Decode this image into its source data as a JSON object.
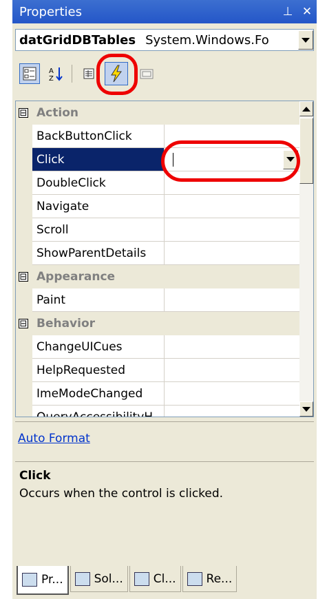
{
  "window": {
    "title": "Properties",
    "pin_icon": "pin-icon",
    "close_icon": "close-icon"
  },
  "object_selector": {
    "name": "datGridDBTables",
    "type": "System.Windows.Fo"
  },
  "toolbar": {
    "buttons": [
      {
        "name": "categorized-button",
        "icon": "categorized-icon",
        "pressed": true
      },
      {
        "name": "alphabetical-button",
        "icon": "alphabetical-icon",
        "pressed": false
      },
      {
        "name": "properties-button",
        "icon": "properties-icon",
        "pressed": false
      },
      {
        "name": "events-button",
        "icon": "lightning-icon",
        "pressed": true
      },
      {
        "name": "property-pages-button",
        "icon": "property-pages-icon",
        "pressed": false
      }
    ]
  },
  "grid": {
    "categories": [
      {
        "label": "Action",
        "items": [
          "BackButtonClick",
          "Click",
          "DoubleClick",
          "Navigate",
          "Scroll",
          "ShowParentDetails"
        ]
      },
      {
        "label": "Appearance",
        "items": [
          "Paint"
        ]
      },
      {
        "label": "Behavior",
        "items": [
          "ChangeUICues",
          "HelpRequested",
          "ImeModeChanged",
          "QueryAccessibilityH"
        ]
      }
    ],
    "selected": "Click",
    "collapse_glyph": "⊟"
  },
  "commands": {
    "auto_format": "Auto Format"
  },
  "description": {
    "title": "Click",
    "text": "Occurs when the control is clicked."
  },
  "tabs": [
    {
      "label": "Pr...",
      "icon": "properties-tab-icon"
    },
    {
      "label": "Sol...",
      "icon": "solution-explorer-icon"
    },
    {
      "label": "Cl...",
      "icon": "class-view-icon"
    },
    {
      "label": "Re...",
      "icon": "resource-view-icon"
    }
  ],
  "colors": {
    "titlebar": "#2456c8",
    "selection": "#0a246a",
    "highlight_ring": "#e00000"
  }
}
